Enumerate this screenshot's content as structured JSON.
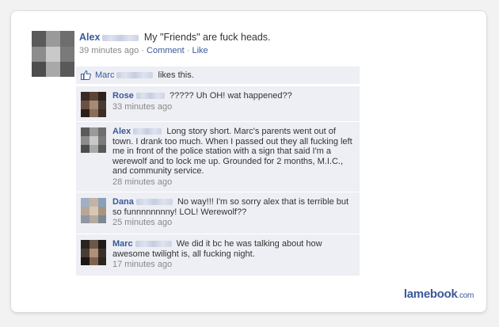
{
  "post": {
    "author_first": "Alex",
    "message": "My \"Friends\" are fuck heads.",
    "time": "39 minutes ago",
    "sep1": "·",
    "comment_link": "Comment",
    "sep2": "·",
    "like_link": "Like"
  },
  "likes": {
    "name_first": "Marc",
    "suffix": "likes this."
  },
  "comments": [
    {
      "author_first": "Rose",
      "text": "????? Uh OH! wat happened??",
      "time": "33 minutes ago"
    },
    {
      "author_first": "Alex",
      "text": "Long story short. Marc's parents went out of town. I drank too much. When I passed out they all fucking left me in front of the police station with a sign that said I'm a werewolf and to lock me up. Grounded for 2 months, M.I.C., and community service.",
      "time": "28 minutes ago"
    },
    {
      "author_first": "Dana",
      "text": "No way!!! I'm so sorry alex that is terrible but so funnnnnnnny! LOL! Werewolf??",
      "time": "25 minutes ago"
    },
    {
      "author_first": "Marc",
      "text": "We did it bc he was talking about how awesome twilight is, all fucking night.",
      "time": "17 minutes ago"
    }
  ],
  "watermark": {
    "name": "lamebook",
    "domain": ".com"
  },
  "colors": {
    "link": "#3b5998",
    "comment_bg": "#edeff4",
    "muted": "#888888"
  },
  "icons": {
    "like": "thumbs-up-icon"
  }
}
